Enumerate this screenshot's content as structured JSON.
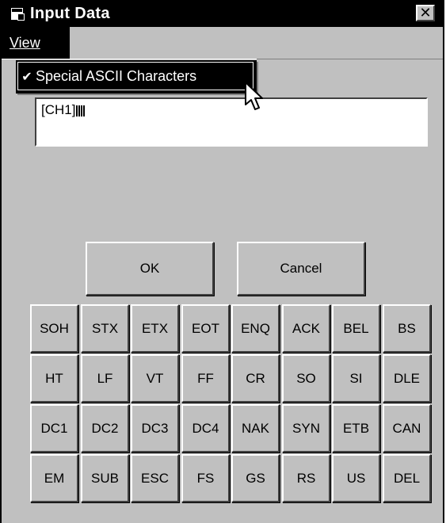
{
  "window": {
    "title": "Input Data",
    "close_label": "✕"
  },
  "menu": {
    "view_label": "View",
    "dropdown": {
      "item_label": "Special ASCII Characters",
      "checked": true
    }
  },
  "input": {
    "value_text": "[CH1]",
    "special_bar_count": 4
  },
  "buttons": {
    "ok": "OK",
    "cancel": "Cancel"
  },
  "keys": [
    [
      "SOH",
      "STX",
      "ETX",
      "EOT",
      "ENQ",
      "ACK",
      "BEL",
      "BS"
    ],
    [
      "HT",
      "LF",
      "VT",
      "FF",
      "CR",
      "SO",
      "SI",
      "DLE"
    ],
    [
      "DC1",
      "DC2",
      "DC3",
      "DC4",
      "NAK",
      "SYN",
      "ETB",
      "CAN"
    ],
    [
      "EM",
      "SUB",
      "ESC",
      "FS",
      "GS",
      "RS",
      "US",
      "DEL"
    ]
  ]
}
